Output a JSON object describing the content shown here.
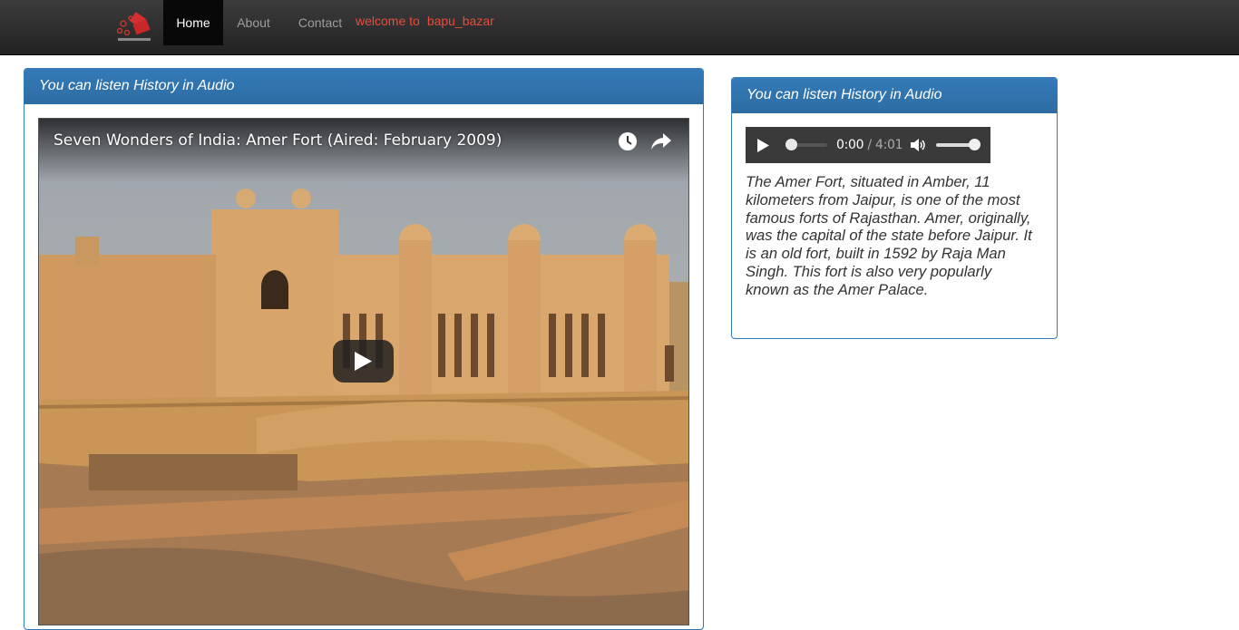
{
  "navbar": {
    "logo_icon": "bapu-bazar-logo",
    "items": [
      {
        "label": "Home",
        "active": true
      },
      {
        "label": "About",
        "active": false
      },
      {
        "label": "Contact",
        "active": false
      }
    ],
    "welcome": {
      "text": "welcome to",
      "user": "bapu_bazar",
      "color": "#e74c3c"
    }
  },
  "video_panel": {
    "heading": "You can listen History in Audio",
    "video": {
      "title": "Seven Wonders of India: Amer Fort (Aired: February 2009)",
      "icons": [
        "watch-later-icon",
        "share-icon",
        "play-icon"
      ]
    }
  },
  "audio_panel": {
    "heading": "You can listen History in Audio",
    "audio": {
      "current_time": "0:00",
      "separator": "/",
      "duration": "4:01",
      "progress": 0,
      "volume": 1.0
    },
    "description": "The Amer Fort, situated in Amber, 11 kilometers from Jaipur, is one of the most famous forts of Rajasthan. Amer, originally, was the capital of the state before Jaipur. It is an old fort, built in 1592 by Raja Man Singh. This fort is also very popularly known as the Amer Palace."
  },
  "colors": {
    "panel_primary": "#337ab7",
    "navbar_bg": "#222222",
    "welcome": "#e74c3c"
  }
}
